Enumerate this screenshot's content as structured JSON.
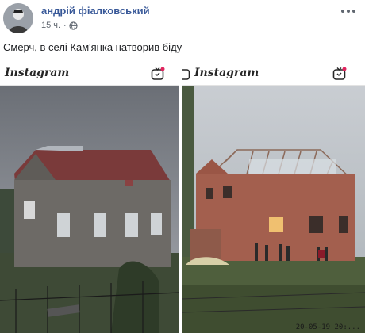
{
  "post": {
    "author": "андрій фіалковський",
    "time": "15 ч.",
    "text": "Смерч, в селі Кам'янка натворив біду"
  },
  "photos": [
    {
      "brand": "Instagram",
      "icon": "igtv-icon"
    },
    {
      "brand": "Instagram",
      "icon": "igtv-icon",
      "timestamp": "20-05-19 20:..."
    }
  ],
  "icons": {
    "more": "more-dots-icon",
    "privacy": "globe-icon",
    "avatar": "avatar-photo"
  },
  "colors": {
    "author": "#385898",
    "meta": "#606770",
    "text": "#1c1e21",
    "notification_dot": "#e0245e"
  }
}
